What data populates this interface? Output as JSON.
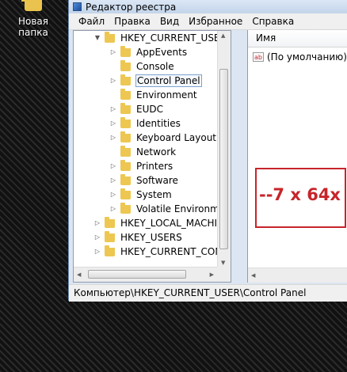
{
  "desktop": {
    "folder_label": "Новая папка"
  },
  "window": {
    "title": "Редактор реестра"
  },
  "menu": [
    "Файл",
    "Правка",
    "Вид",
    "Избранное",
    "Справка"
  ],
  "tree": [
    {
      "label": "HKEY_CURRENT_USER",
      "expander": "open",
      "selected": false
    },
    {
      "label": "AppEvents",
      "expander": "closed",
      "selected": false
    },
    {
      "label": "Console",
      "expander": "none",
      "selected": false
    },
    {
      "label": "Control Panel",
      "expander": "closed",
      "selected": true
    },
    {
      "label": "Environment",
      "expander": "none",
      "selected": false
    },
    {
      "label": "EUDC",
      "expander": "closed",
      "selected": false
    },
    {
      "label": "Identities",
      "expander": "closed",
      "selected": false
    },
    {
      "label": "Keyboard Layout",
      "expander": "closed",
      "selected": false
    },
    {
      "label": "Network",
      "expander": "none",
      "selected": false
    },
    {
      "label": "Printers",
      "expander": "closed",
      "selected": false
    },
    {
      "label": "Software",
      "expander": "closed",
      "selected": false
    },
    {
      "label": "System",
      "expander": "closed",
      "selected": false
    },
    {
      "label": "Volatile Environment",
      "expander": "closed",
      "selected": false
    },
    {
      "label": "HKEY_LOCAL_MACHINE",
      "expander": "closed",
      "selected": false
    },
    {
      "label": "HKEY_USERS",
      "expander": "closed",
      "selected": false
    },
    {
      "label": "HKEY_CURRENT_CONFIG",
      "expander": "closed",
      "selected": false
    }
  ],
  "values": {
    "column_name": "Имя",
    "rows": [
      {
        "icon": "ab-string-icon",
        "name": "(По умолчанию)"
      }
    ]
  },
  "annotation": {
    "text": "--7 x 64x",
    "color": "#c7252a"
  },
  "statusbar": {
    "path": "Компьютер\\HKEY_CURRENT_USER\\Control Panel"
  },
  "colors": {
    "folder": "#edc752",
    "window_frame": "#dce6f2",
    "selection_border": "#7da2ce"
  }
}
